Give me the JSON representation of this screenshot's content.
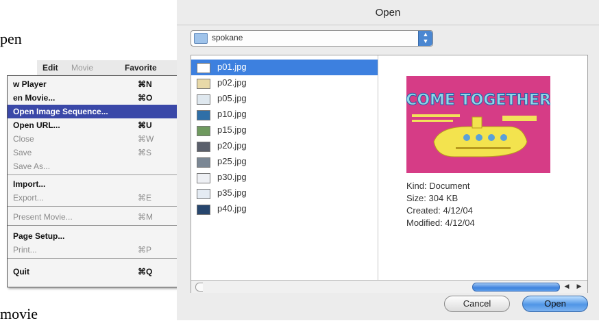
{
  "document": {
    "top_fragment": "pen",
    "bottom_fragment": "movie"
  },
  "menu": {
    "menubar": {
      "edit": "Edit",
      "movie": "Movie",
      "favorites": "Favorite"
    },
    "items": [
      {
        "label": "w Player",
        "shortcut": "⌘N",
        "state": "enabled"
      },
      {
        "label": "en Movie...",
        "shortcut": "⌘O",
        "state": "enabled"
      },
      {
        "label": "Open Image Sequence...",
        "shortcut": "",
        "state": "highlighted"
      },
      {
        "label": "Open URL...",
        "shortcut": "⌘U",
        "state": "enabled"
      },
      {
        "label": "Close",
        "shortcut": "⌘W",
        "state": "disabled"
      },
      {
        "label": "Save",
        "shortcut": "⌘S",
        "state": "disabled"
      },
      {
        "label": "Save As...",
        "shortcut": "",
        "state": "disabled"
      },
      {
        "label": "Import...",
        "shortcut": "",
        "state": "enabled"
      },
      {
        "label": "Export...",
        "shortcut": "⌘E",
        "state": "disabled"
      },
      {
        "label": "Present Movie...",
        "shortcut": "⌘M",
        "state": "disabled"
      },
      {
        "label": "Page Setup...",
        "shortcut": "",
        "state": "enabled"
      },
      {
        "label": "Print...",
        "shortcut": "⌘P",
        "state": "disabled"
      },
      {
        "label": "Quit",
        "shortcut": "⌘Q",
        "state": "enabled"
      }
    ]
  },
  "dialog": {
    "title": "Open",
    "location": "spokane",
    "files": [
      {
        "name": "p01.jpg",
        "selected": true,
        "icon": "image-doc-icon"
      },
      {
        "name": "p02.jpg",
        "selected": false,
        "icon": "image-thumb-icon"
      },
      {
        "name": "p05.jpg",
        "selected": false,
        "icon": "image-doc-icon"
      },
      {
        "name": "p10.jpg",
        "selected": false,
        "icon": "image-thumb-icon"
      },
      {
        "name": "p15.jpg",
        "selected": false,
        "icon": "image-thumb-icon"
      },
      {
        "name": "p20.jpg",
        "selected": false,
        "icon": "image-thumb-icon"
      },
      {
        "name": "p25.jpg",
        "selected": false,
        "icon": "image-thumb-icon"
      },
      {
        "name": "p30.jpg",
        "selected": false,
        "icon": "image-doc-icon"
      },
      {
        "name": "p35.jpg",
        "selected": false,
        "icon": "image-doc-icon"
      },
      {
        "name": "p40.jpg",
        "selected": false,
        "icon": "image-thumb-icon"
      }
    ],
    "preview": {
      "image_text": "COME TOGETHER",
      "kind": "Kind: Document",
      "size": "Size: 304 KB",
      "created": "Created: 4/12/04",
      "modified": "Modified: 4/12/04"
    },
    "buttons": {
      "cancel": "Cancel",
      "open": "Open"
    },
    "colors": {
      "selection": "#3d80df",
      "menu_highlight": "#3a48a8",
      "preview_bg": "#d63c86"
    }
  }
}
